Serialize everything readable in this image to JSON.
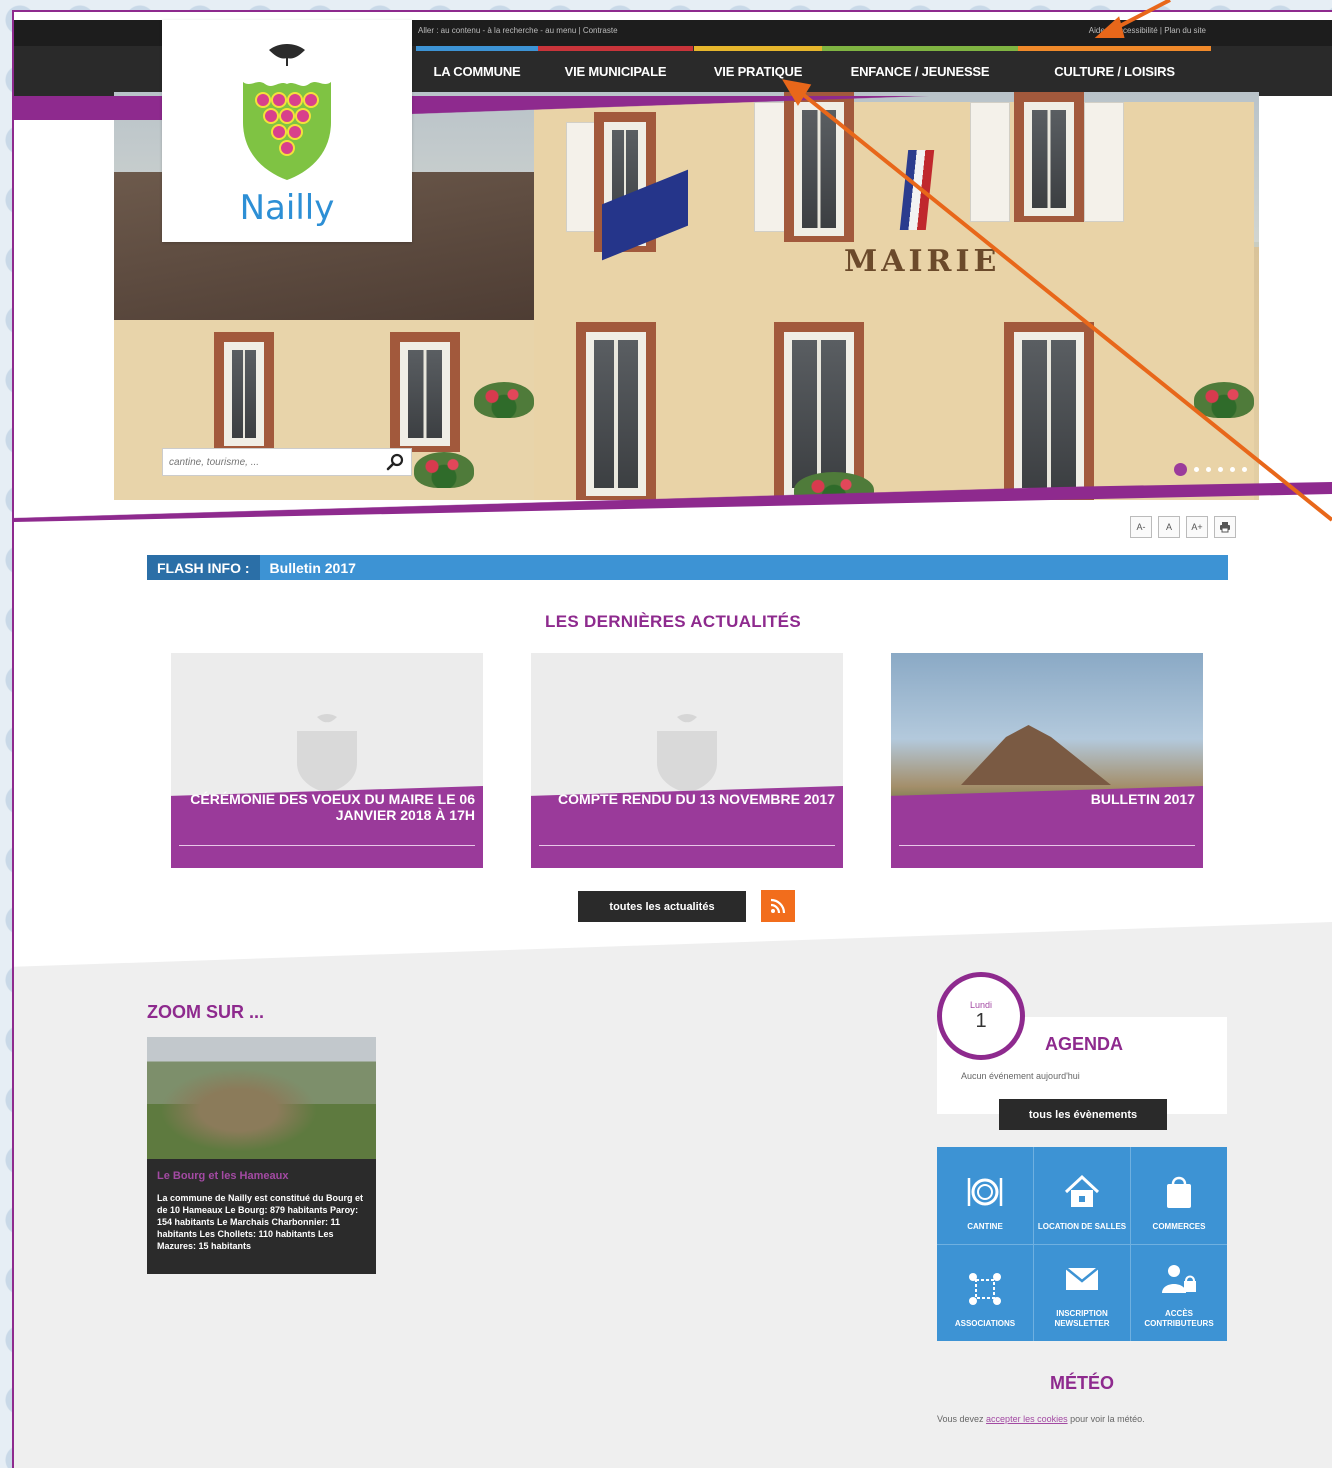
{
  "utility": {
    "links": "Aller : au contenu - à la recherche - au menu | Contraste",
    "right": "Aide & accessibilité | Plan du site"
  },
  "menu": [
    {
      "label": "LA COMMUNE",
      "color": "#3d93d4"
    },
    {
      "label": "VIE MUNICIPALE",
      "color": "#c8343a"
    },
    {
      "label": "VIE PRATIQUE",
      "color": "#e6b62c"
    },
    {
      "label": "ENFANCE / JEUNESSE",
      "color": "#7fb442"
    },
    {
      "label": "CULTURE / LOISIRS",
      "color": "#f0892a"
    }
  ],
  "logo": {
    "name": "Nailly"
  },
  "hero": {
    "sign": "MAIRIE"
  },
  "search": {
    "placeholder": "cantine, tourisme, ..."
  },
  "tools": {
    "smaller": "A-",
    "normal": "A",
    "bigger": "A+"
  },
  "flash": {
    "label": "FLASH INFO :",
    "text": "Bulletin 2017"
  },
  "news": {
    "section_title": "LES DERNIÈRES ACTUALITÉS",
    "items": [
      {
        "title": "CÉRÉMONIE DES VOEUX DU MAIRE LE 06 JANVIER 2018 À 17H"
      },
      {
        "title": "COMPTE RENDU DU 13 NOVEMBRE 2017"
      },
      {
        "title": "BULLETIN 2017"
      }
    ],
    "all_button": "toutes les actualités"
  },
  "zoom": {
    "title": "ZOOM SUR ...",
    "subtitle": "Le Bourg et les Hameaux",
    "text": "La commune de Nailly est constitué du Bourg et de 10 Hameaux Le Bourg: 879 habitants Paroy: 154 habitants Le Marchais Charbonnier: 11 habitants Les Chollets: 110 habitants Les Mazures: 15 habitants"
  },
  "agenda": {
    "day_name": "Lundi",
    "day_number": "1",
    "title": "AGENDA",
    "empty": "Aucun événement aujourd'hui",
    "button": "tous les évènements"
  },
  "tiles": [
    {
      "label": "CANTINE",
      "icon": "plate-icon"
    },
    {
      "label": "LOCATION DE SALLES",
      "icon": "house-icon"
    },
    {
      "label": "COMMERCES",
      "icon": "shopping-bag-icon"
    },
    {
      "label": "ASSOCIATIONS",
      "icon": "people-network-icon"
    },
    {
      "label": "INSCRIPTION NEWSLETTER",
      "icon": "envelope-icon"
    },
    {
      "label": "ACCÈS CONTRIBUTEURS",
      "icon": "user-lock-icon"
    }
  ],
  "meteo": {
    "title": "MÉTÉO",
    "text_before": "Vous devez ",
    "link": "accepter les cookies",
    "text_after": " pour voir la météo."
  },
  "colors": {
    "accent": "#8e2a8e",
    "info_blue": "#3d93d4",
    "rss": "#f26d1c",
    "annotation": "#e8671a"
  }
}
